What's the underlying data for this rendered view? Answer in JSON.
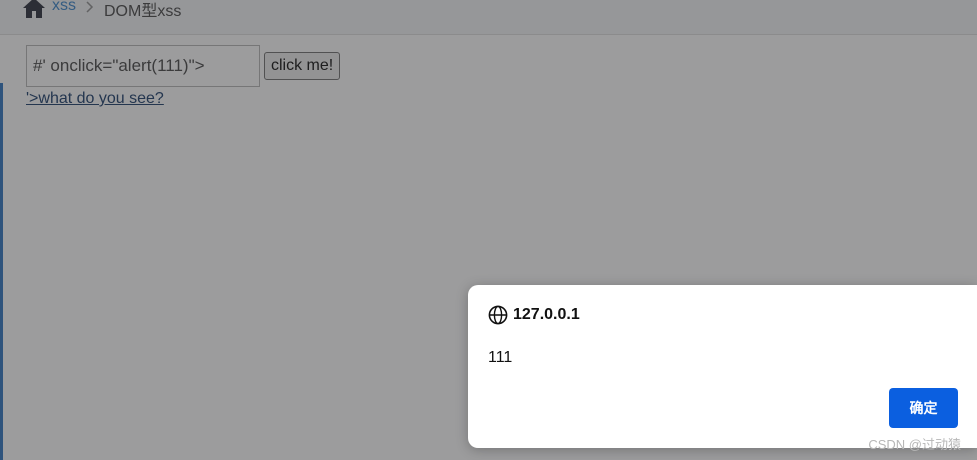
{
  "breadcrumb": {
    "home_icon": "home-icon",
    "parent": "xss",
    "current": "DOM型xss"
  },
  "form": {
    "input_value": "#' onclick=\"alert(111)\">",
    "button_label": "click me!"
  },
  "output": {
    "link_text": "'>what do you see?"
  },
  "dialog": {
    "icon": "globe-icon",
    "origin": "127.0.0.1",
    "message": "111",
    "ok_label": "确定"
  },
  "watermark": "CSDN @过动猿",
  "colors": {
    "accent": "#0b5fe0",
    "link": "#4a8fd0",
    "overlay": "rgba(25,25,28,0.43)"
  }
}
